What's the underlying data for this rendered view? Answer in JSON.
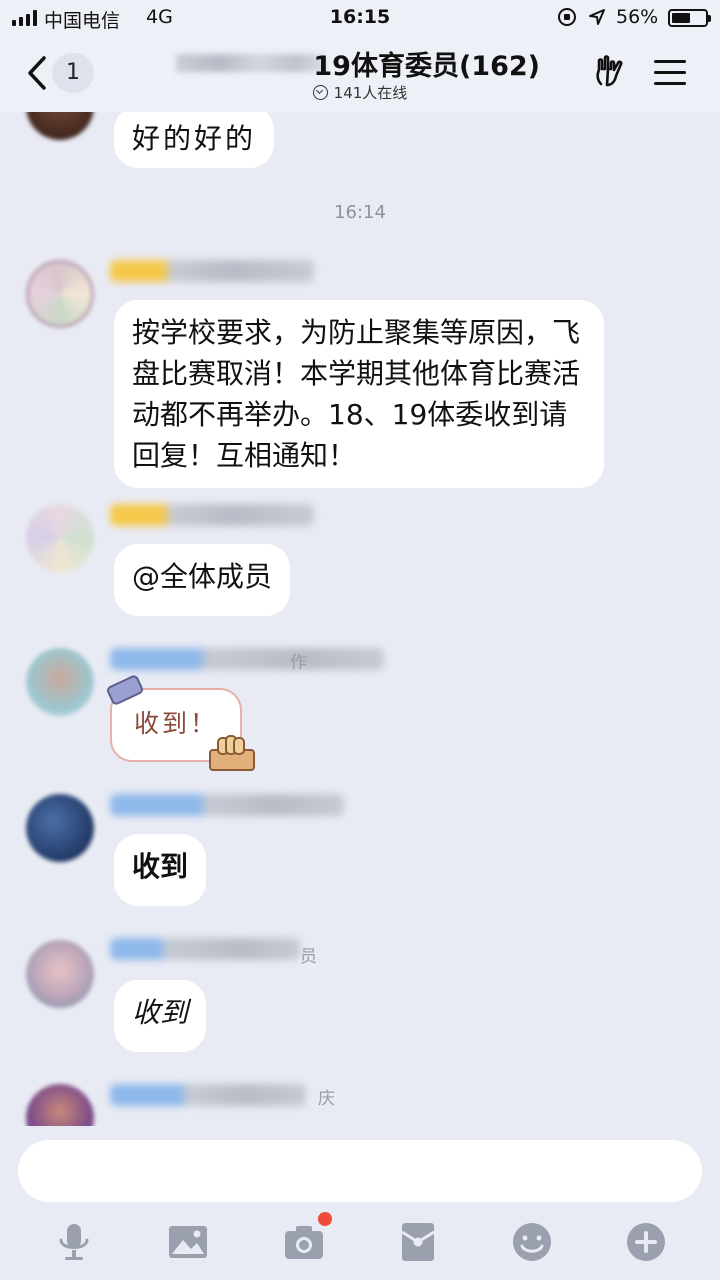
{
  "status_bar": {
    "carrier": "中国电信",
    "network": "4G",
    "time": "16:15",
    "battery_percent": "56%",
    "battery_level": 0.56
  },
  "header": {
    "unread_count": "1",
    "title_visible": "19体育委员(162)",
    "online": "141人在线"
  },
  "messages": [
    {
      "text": "好的好的"
    },
    {
      "text": "按学校要求，为防止聚集等原因，飞盘比赛取消！本学期其他体育比赛活动都不再举办。18、19体委收到请回复！互相通知！"
    },
    {
      "text": "@全体成员"
    },
    {
      "sticker_text": "收到！"
    },
    {
      "text": "收到"
    },
    {
      "text": "收到"
    }
  ],
  "timestamp": "16:14",
  "name_fragments": {
    "member_4": "作",
    "member_6": "员",
    "member_7": "庆"
  },
  "toolbar": {
    "icons": [
      "microphone-icon",
      "image-icon",
      "camera-icon",
      "red-packet-icon",
      "emoji-icon",
      "plus-icon"
    ],
    "accent": "#9aa0ae",
    "badge_color": "#f04a3a"
  }
}
